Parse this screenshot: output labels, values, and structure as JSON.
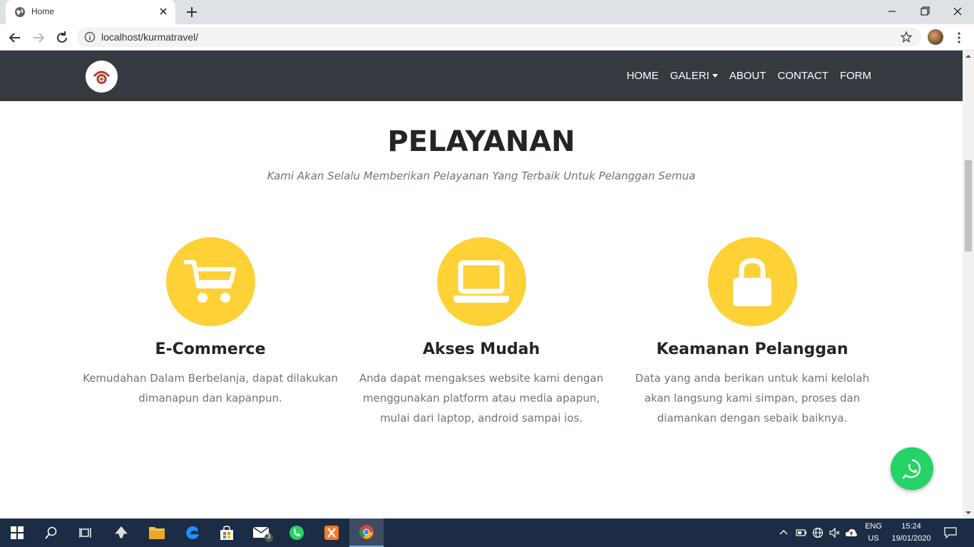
{
  "browser": {
    "tab_title": "Home",
    "url": "localhost/kurmatravel/"
  },
  "navbar": {
    "links": [
      "HOME",
      "GALERI",
      "ABOUT",
      "CONTACT",
      "FORM"
    ]
  },
  "section": {
    "title": "PELAYANAN",
    "subtitle": "Kami Akan Selalu Memberikan Pelayanan Yang Terbaik Untuk Pelanggan Semua"
  },
  "features": [
    {
      "icon": "shopping-cart-icon",
      "title": "E-Commerce",
      "text": "Kemudahan Dalam Berbelanja, dapat dilakukan dimanapun dan kapanpun."
    },
    {
      "icon": "laptop-icon",
      "title": "Akses Mudah",
      "text": "Anda dapat mengakses website kami dengan menggunakan platform atau media apapun, mulai dari laptop, android sampai ios."
    },
    {
      "icon": "lock-icon",
      "title": "Keamanan Pelanggan",
      "text": "Data yang anda berikan untuk kami kelolah akan langsung kami simpan, proses dan diamankan dengan sebaik baiknya."
    }
  ],
  "colors": {
    "accent": "#fed136",
    "navbar": "#343a40",
    "whatsapp": "#25d366"
  },
  "taskbar": {
    "mail_badge": "3",
    "lang_top": "ENG",
    "lang_bottom": "US",
    "time": "15:24",
    "date": "19/01/2020"
  }
}
